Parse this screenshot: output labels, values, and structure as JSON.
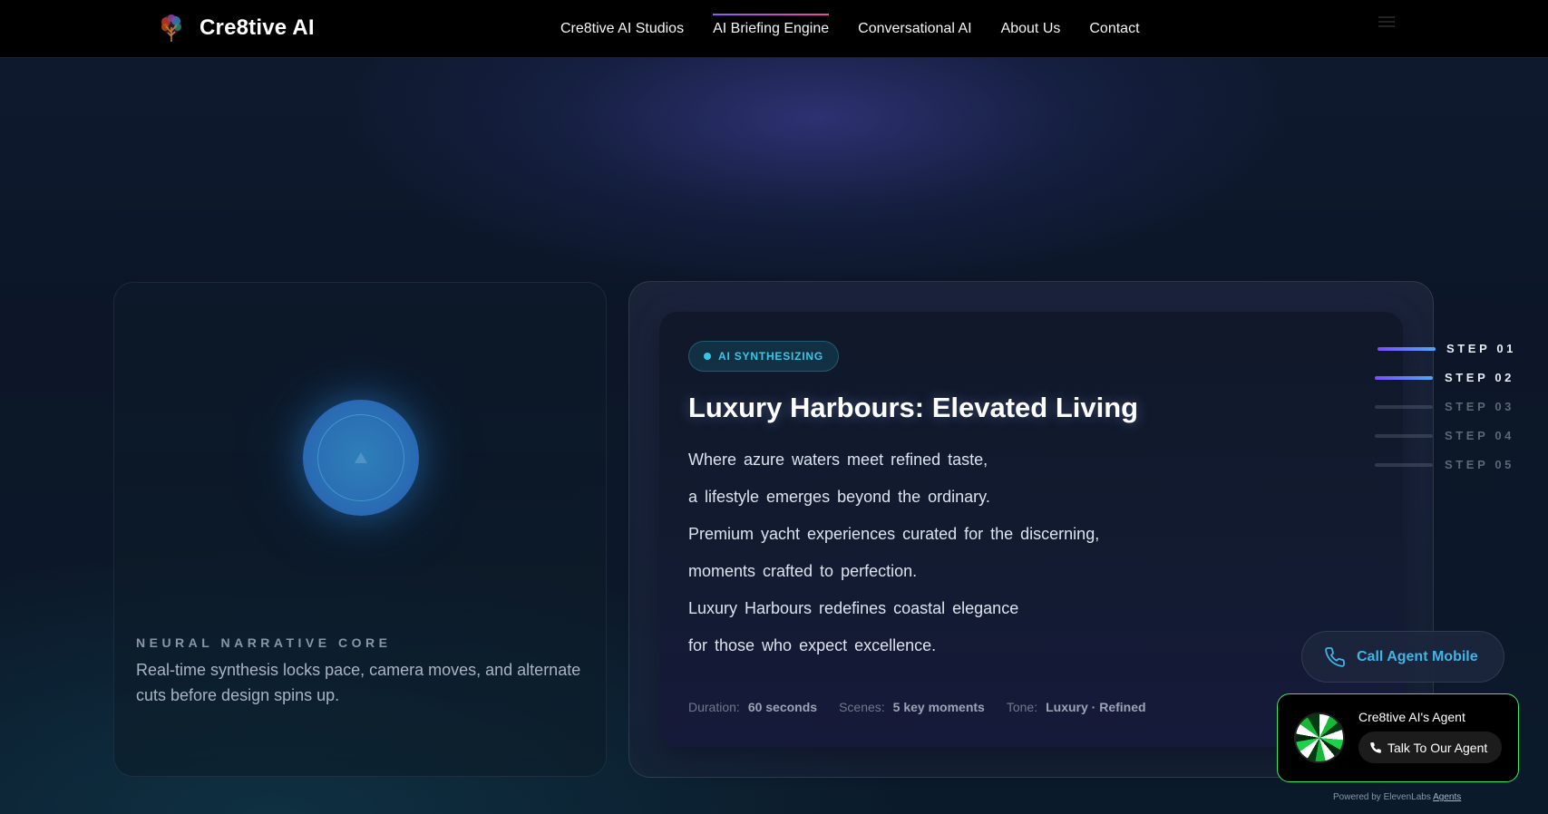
{
  "nav": {
    "brand": "Cre8tive AI",
    "links": [
      {
        "label": "Cre8tive AI Studios",
        "active": false
      },
      {
        "label": "AI Briefing Engine",
        "active": true
      },
      {
        "label": "Conversational AI",
        "active": false
      },
      {
        "label": "About Us",
        "active": false
      },
      {
        "label": "Contact",
        "active": false
      }
    ]
  },
  "core": {
    "title": "NEURAL NARRATIVE CORE",
    "description": "Real-time synthesis locks pace, camera moves, and alternate cuts before design spins up."
  },
  "briefing": {
    "badge": "AI SYNTHESIZING",
    "headline": "Luxury Harbours: Elevated Living",
    "lines": [
      "Where azure waters meet refined taste,",
      "a lifestyle emerges beyond the ordinary.",
      "Premium yacht experiences curated for the discerning,",
      "moments crafted to perfection.",
      "Luxury Harbours redefines coastal elegance",
      "for those who expect excellence."
    ],
    "meta": [
      {
        "label": "Duration:",
        "value": "60 seconds"
      },
      {
        "label": "Scenes:",
        "value": "5 key moments"
      },
      {
        "label": "Tone:",
        "value": "Luxury · Refined"
      }
    ]
  },
  "steps": [
    "STEP 01",
    "STEP 02",
    "STEP 03",
    "STEP 04",
    "STEP 05"
  ],
  "call_button": {
    "label": "Call Agent Mobile"
  },
  "agent": {
    "name": "Cre8tive AI's Agent",
    "button": "Talk To Our Agent",
    "powered_prefix": "Powered by ElevenLabs",
    "powered_link": "Agents"
  },
  "colors": {
    "accent_cyan": "#3fb5e6",
    "active_gradient_start": "#7c4dff",
    "active_gradient_end": "#4fa8f6",
    "widget_border": "#3ae86a"
  }
}
